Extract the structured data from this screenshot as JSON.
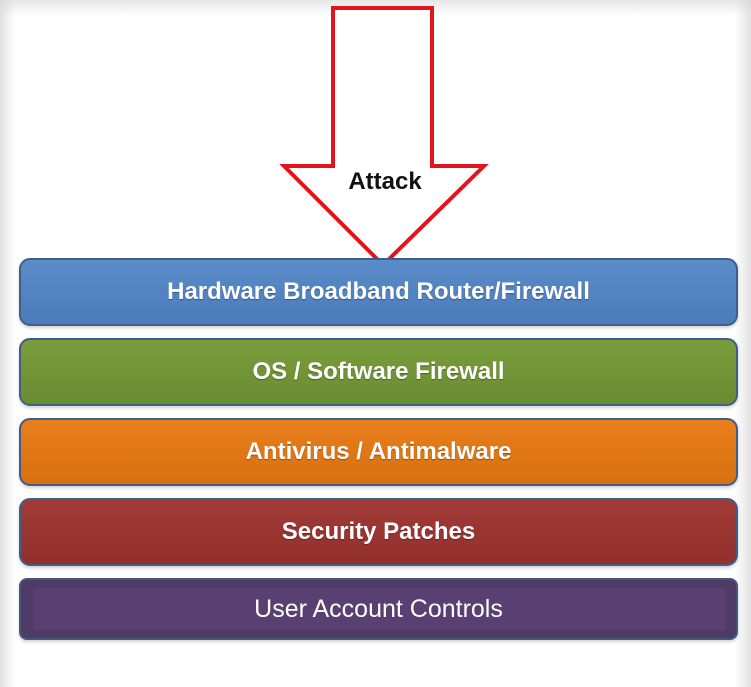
{
  "arrow": {
    "label": "Attack",
    "fill": "#ffffff",
    "stroke": "#e3141b"
  },
  "layers": [
    {
      "label": "Hardware Broadband Router/Firewall",
      "color": "#4f81bd"
    },
    {
      "label": "OS / Software Firewall",
      "color": "#6e9135"
    },
    {
      "label": "Antivirus / Antimalware",
      "color": "#e07314"
    },
    {
      "label": "Security Patches",
      "color": "#963430"
    },
    {
      "label": "User Account Controls",
      "color": "#553d6d"
    }
  ]
}
